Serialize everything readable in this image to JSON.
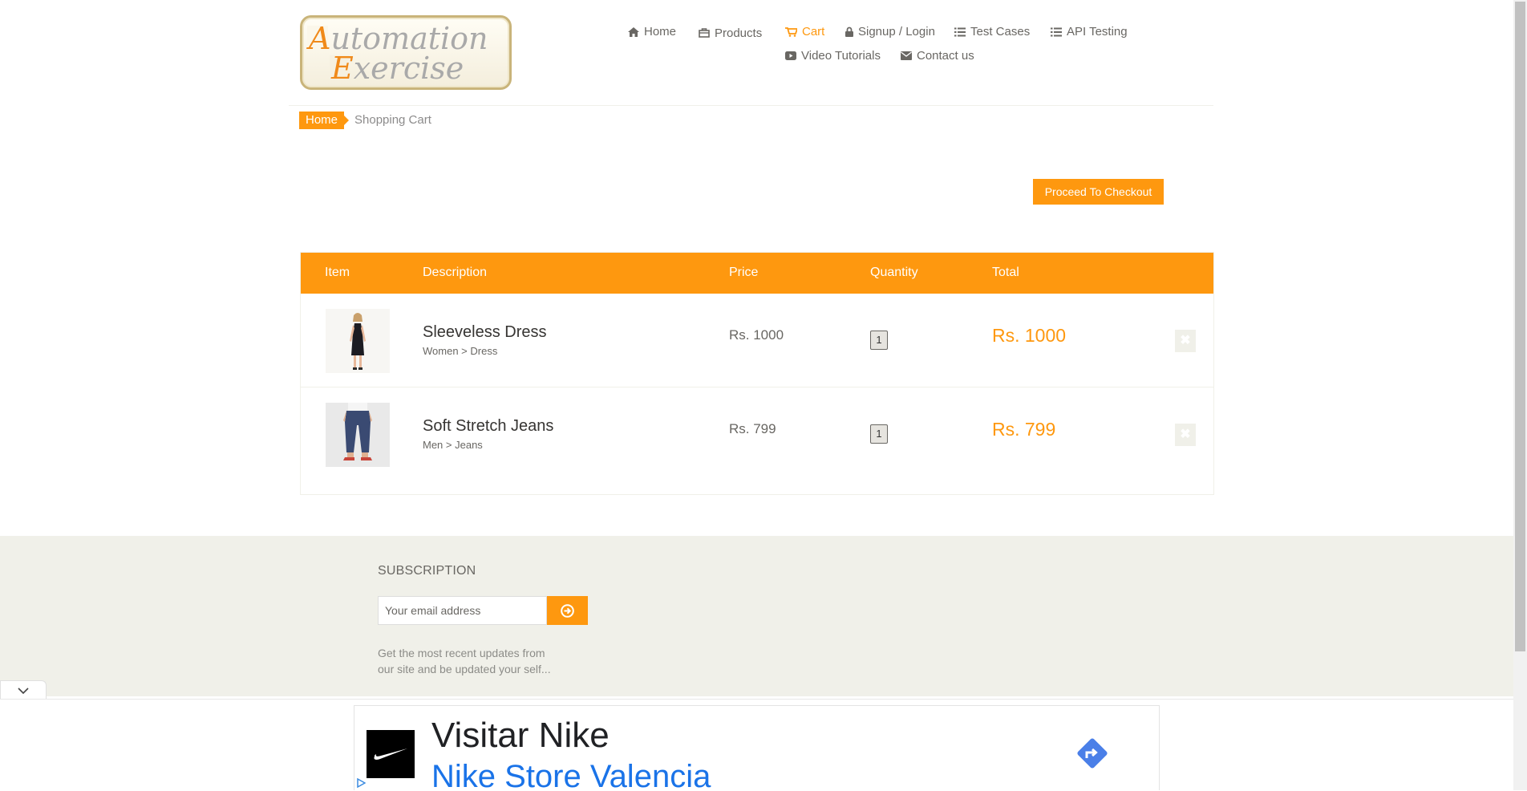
{
  "logo": {
    "line1": "Automation",
    "line2": "Exercise"
  },
  "nav": [
    {
      "label": "Home",
      "icon": "home-icon"
    },
    {
      "label": "Products",
      "icon": "shopping-bag-icon"
    },
    {
      "label": "Cart",
      "icon": "cart-icon"
    },
    {
      "label": "Signup / Login",
      "icon": "lock-icon"
    },
    {
      "label": "Test Cases",
      "icon": "list-icon"
    },
    {
      "label": "API Testing",
      "icon": "list-icon"
    },
    {
      "label": "Video Tutorials",
      "icon": "youtube-play-icon"
    },
    {
      "label": "Contact us",
      "icon": "envelope-icon"
    }
  ],
  "breadcrumb": {
    "home": "Home",
    "current": "Shopping Cart"
  },
  "checkout_label": "Proceed To Checkout",
  "cart": {
    "headers": {
      "item": "Item",
      "description": "Description",
      "price": "Price",
      "quantity": "Quantity",
      "total": "Total"
    },
    "rows": [
      {
        "name": "Sleeveless Dress",
        "category": "Women > Dress",
        "price": "Rs. 1000",
        "quantity": "1",
        "total": "Rs. 1000"
      },
      {
        "name": "Soft Stretch Jeans",
        "category": "Men > Jeans",
        "price": "Rs. 799",
        "quantity": "1",
        "total": "Rs. 799"
      }
    ],
    "delete_glyph": "✖"
  },
  "subscription": {
    "title": "SUBSCRIPTION",
    "placeholder": "Your email address",
    "text": "Get the most recent updates from our site and be updated your self..."
  },
  "ad": {
    "title": "Visitar Nike",
    "subtitle": "Nike Store Valencia"
  },
  "colors": {
    "accent": "#FE980F",
    "text": "#696763",
    "footer_bg": "#F0F0E9",
    "ad_link": "#1A73E8"
  }
}
